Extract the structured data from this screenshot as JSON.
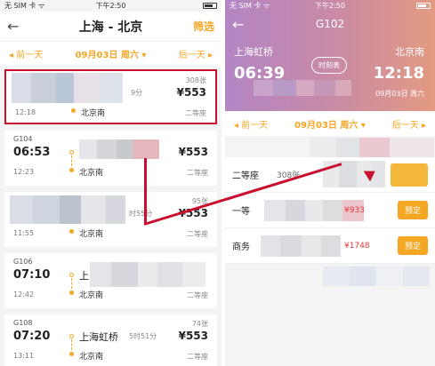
{
  "left": {
    "status": {
      "carrier": "无 SIM 卡 ᯤ",
      "time": "下午2:50"
    },
    "nav": {
      "title": "上海 - 北京",
      "filter": "筛选"
    },
    "datebar": {
      "prev": "◂ 前一天",
      "date": "09月03日 周六 ▾",
      "next": "后一天 ▸"
    },
    "trains": [
      {
        "code": "",
        "dep": "",
        "arr": "12:18",
        "from": "",
        "to": "北京南",
        "dur": "9分",
        "seats": "308张",
        "price": "¥553",
        "cls": "二等座"
      },
      {
        "code": "G104",
        "dep": "06:53",
        "arr": "12:23",
        "from": "",
        "to": "北京南",
        "dur": "",
        "seats": "",
        "price": "¥553",
        "cls": "二等座"
      },
      {
        "code": "",
        "dep": "",
        "arr": "11:55",
        "from": "",
        "to": "北京南",
        "dur": "时55分",
        "seats": "95张",
        "price": "¥553",
        "cls": "二等座"
      },
      {
        "code": "G106",
        "dep": "07:10",
        "arr": "12:42",
        "from": "上",
        "to": "北京南",
        "dur": "",
        "seats": "",
        "price": "",
        "cls": "二等座"
      },
      {
        "code": "G108",
        "dep": "07:20",
        "arr": "13:11",
        "from": "上海虹桥",
        "to": "北京南",
        "dur": "5时51分",
        "seats": "74张",
        "price": "¥553",
        "cls": "二等座"
      }
    ]
  },
  "right": {
    "status": {
      "carrier": "无 SIM 卡 ᯤ",
      "time": "下午2:50"
    },
    "nav": {
      "title": "G102"
    },
    "hero": {
      "from": "上海虹桥",
      "to": "北京南",
      "dep": "06:39",
      "arr": "12:18",
      "schedule_button": "时刻表",
      "date": "09月03日 周六"
    },
    "datebar": {
      "prev": "◂ 前一天",
      "date": "09月03日 周六 ▾",
      "next": "后一天 ▸"
    },
    "seats": [
      {
        "cls": "二等座",
        "cnt": "308张",
        "price": "",
        "button": ""
      },
      {
        "cls": "一等",
        "cnt": "",
        "price": "¥933",
        "button": "预定"
      },
      {
        "cls": "商务",
        "cnt": "",
        "price": "¥1748",
        "button": "预定"
      }
    ]
  },
  "colors": {
    "accent": "#f5a623",
    "highlight": "#c8102e",
    "price_red": "#e53a3a"
  }
}
